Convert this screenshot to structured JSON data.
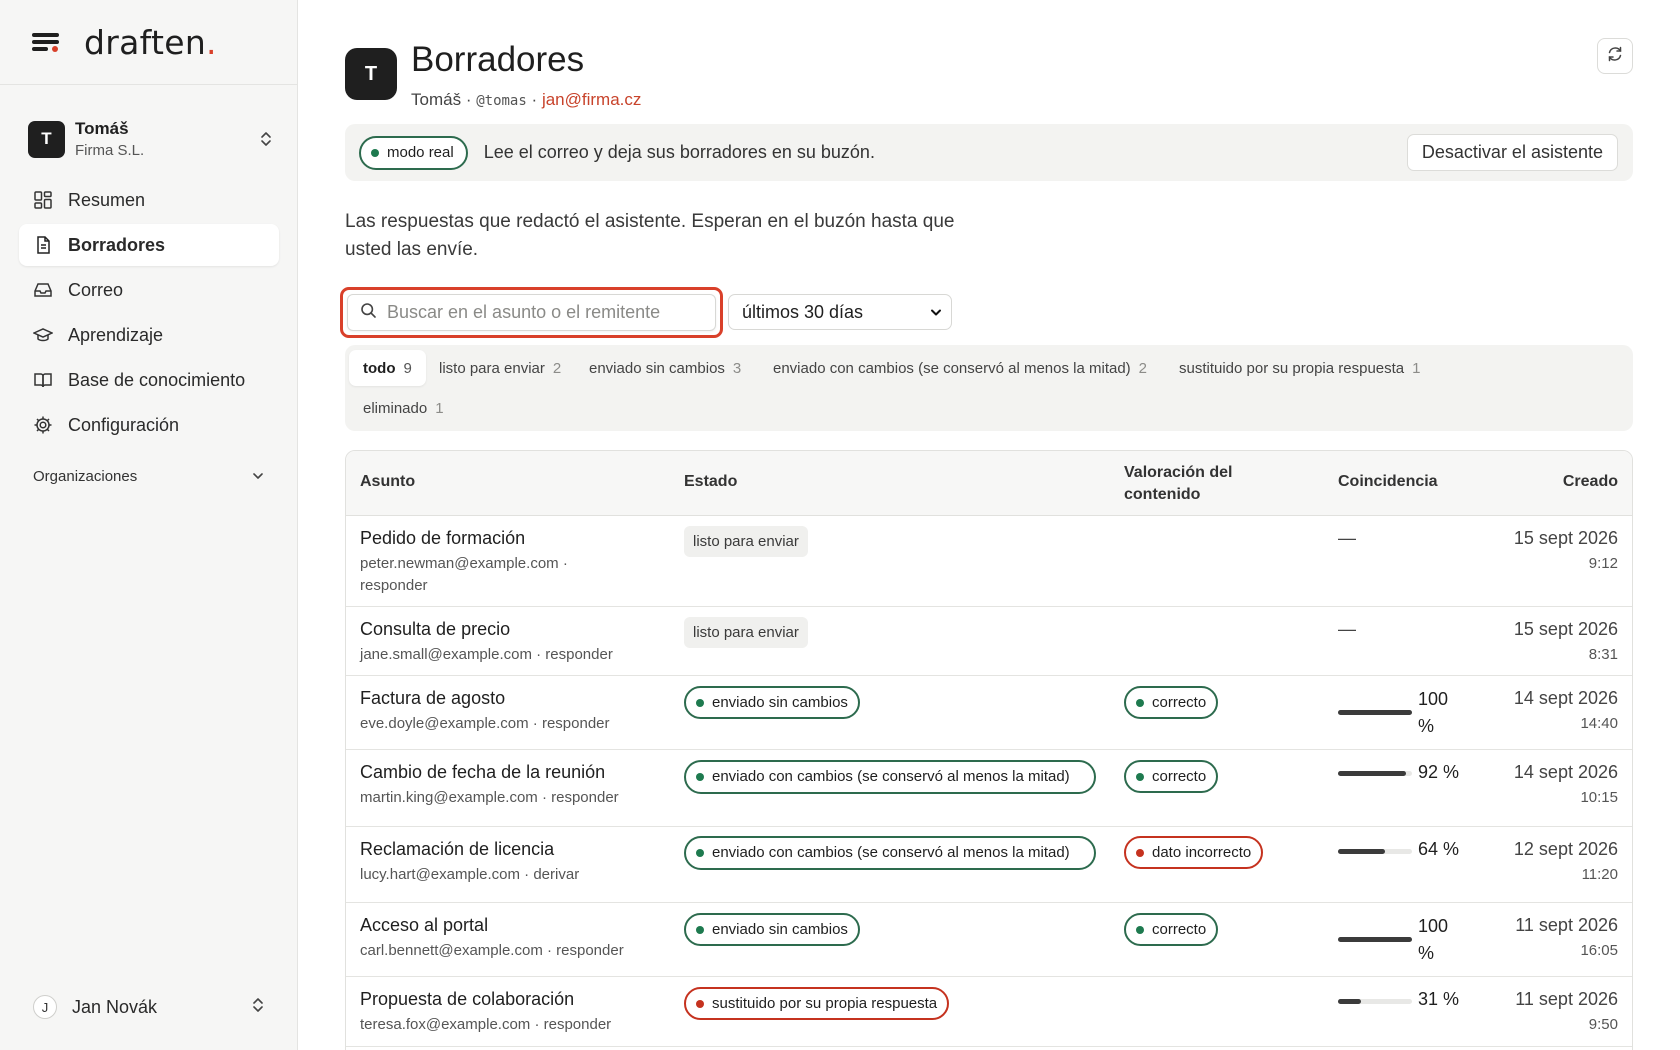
{
  "brand": {
    "name": "draften",
    "dot": "."
  },
  "tenant": {
    "initial": "T",
    "name": "Tomáš",
    "company": "Firma S.L."
  },
  "nav": [
    {
      "label": "Resumen",
      "icon": "dashboard-icon"
    },
    {
      "label": "Borradores",
      "icon": "document-icon",
      "active": true
    },
    {
      "label": "Correo",
      "icon": "inbox-icon"
    },
    {
      "label": "Aprendizaje",
      "icon": "graduation-cap-icon"
    },
    {
      "label": "Base de conocimiento",
      "icon": "book-icon"
    },
    {
      "label": "Configuración",
      "icon": "gear-icon"
    }
  ],
  "orgs": {
    "label": "Organizaciones"
  },
  "user": {
    "initial": "J",
    "name": "Jan Novák"
  },
  "header": {
    "initial": "T",
    "title": "Borradores",
    "name": "Tomáš",
    "sep": "·",
    "handle": "@tomas",
    "email": "jan@firma.cz"
  },
  "banner": {
    "mode": "modo real",
    "text": "Lee el correo y deja sus borradores en su buzón.",
    "button": "Desactivar el asistente"
  },
  "description": "Las respuestas que redactó el asistente. Esperan en el buzón hasta que usted las envíe.",
  "search": {
    "placeholder": "Buscar en el asunto o el remitente"
  },
  "period": {
    "selected": "últimos 30 días"
  },
  "filters": [
    {
      "label": "todo",
      "count": "9",
      "active": true
    },
    {
      "label": "listo para enviar",
      "count": "2"
    },
    {
      "label": "enviado sin cambios",
      "count": "3"
    },
    {
      "label": "enviado con cambios (se conservó al menos la mitad)",
      "count": "2"
    },
    {
      "label": "sustituido por su propia respuesta",
      "count": "1"
    },
    {
      "label": "eliminado",
      "count": "1"
    }
  ],
  "table": {
    "headers": {
      "subject": "Asunto",
      "status": "Estado",
      "rating": "Valoración del contenido",
      "match": "Coincidencia",
      "created": "Creado"
    },
    "rows": [
      {
        "subject": "Pedido de formación",
        "from": "peter.newman@example.com · responder",
        "status": "listo para enviar",
        "status_kind": "plain",
        "rating": "",
        "match": "—",
        "match_value": null,
        "date": "15 sept 2026",
        "time": "9:12"
      },
      {
        "subject": "Consulta de precio",
        "from": "jane.small@example.com · responder",
        "status": "listo para enviar",
        "status_kind": "plain",
        "rating": "",
        "match": "—",
        "match_value": null,
        "date": "15 sept 2026",
        "time": "8:31"
      },
      {
        "subject": "Factura de agosto",
        "from": "eve.doyle@example.com · responder",
        "status": "enviado sin cambios",
        "status_kind": "green",
        "rating": "correcto",
        "rating_kind": "green",
        "match": "100 %",
        "match_value": 100,
        "date": "14 sept 2026",
        "time": "14:40"
      },
      {
        "subject": "Cambio de fecha de la reunión",
        "from": "martin.king@example.com · responder",
        "status": "enviado con cambios (se conservó al menos la mitad)",
        "status_kind": "green-wide",
        "rating": "correcto",
        "rating_kind": "green",
        "match": "92 %",
        "match_value": 92,
        "date": "14 sept 2026",
        "time": "10:15"
      },
      {
        "subject": "Reclamación de licencia",
        "from": "lucy.hart@example.com · derivar",
        "status": "enviado con cambios (se conservó al menos la mitad)",
        "status_kind": "green-wide",
        "rating": "dato incorrecto",
        "rating_kind": "red",
        "match": "64 %",
        "match_value": 64,
        "date": "12 sept 2026",
        "time": "11:20"
      },
      {
        "subject": "Acceso al portal",
        "from": "carl.bennett@example.com · responder",
        "status": "enviado sin cambios",
        "status_kind": "green",
        "rating": "correcto",
        "rating_kind": "green",
        "match": "100 %",
        "match_value": 100,
        "date": "11 sept 2026",
        "time": "16:05"
      },
      {
        "subject": "Propuesta de colaboración",
        "from": "teresa.fox@example.com · responder",
        "status": "sustituido por su propia respuesta",
        "status_kind": "red",
        "rating": "",
        "match": "31 %",
        "match_value": 31,
        "date": "11 sept 2026",
        "time": "9:50"
      }
    ]
  },
  "colors": {
    "accent": "#d8402a",
    "green": "#2d6b4e",
    "red": "#c5321f"
  }
}
